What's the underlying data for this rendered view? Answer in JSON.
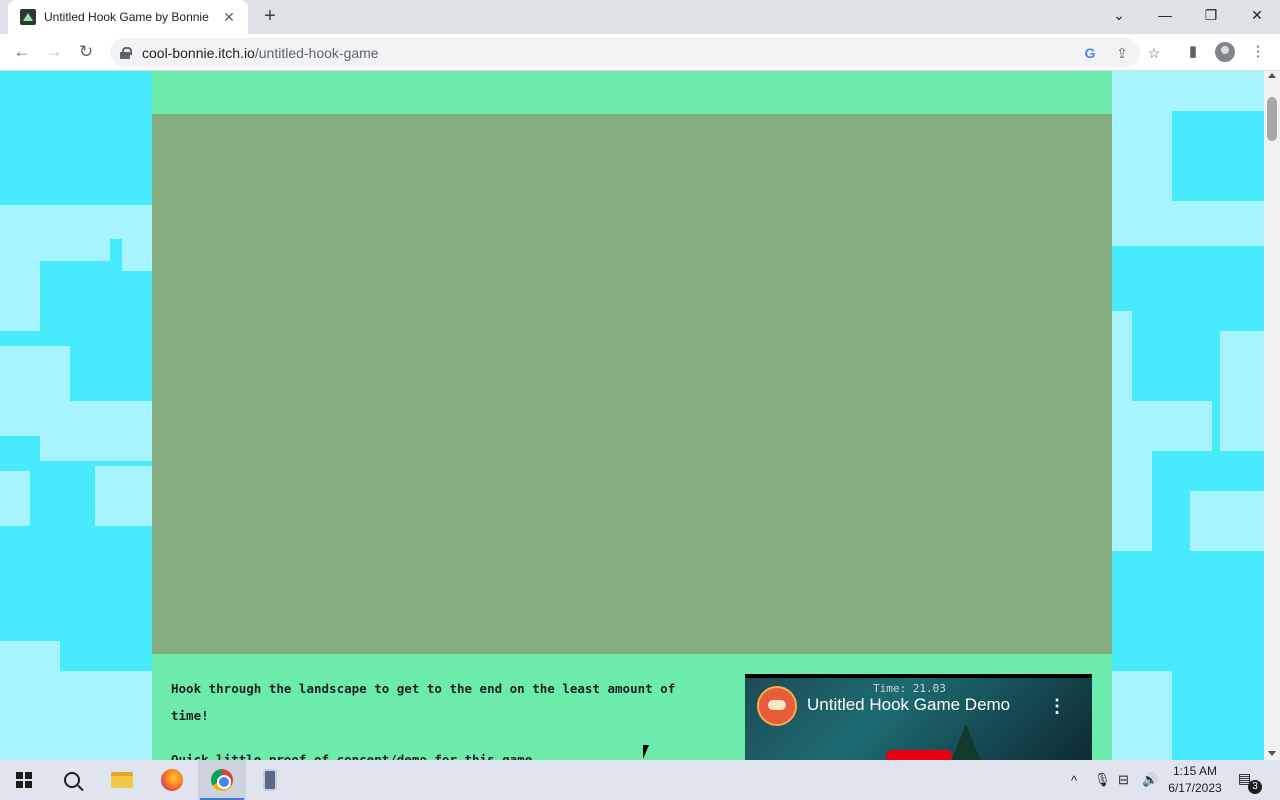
{
  "browser": {
    "tab_title": "Untitled Hook Game by Bonnie",
    "tab_close": "✕",
    "new_tab": "+",
    "url_host": "cool-bonnie.itch.io",
    "url_path": "/untitled-hook-game",
    "controls": {
      "tab_search": "⌄",
      "minimize": "—",
      "restore": "❐",
      "close": "✕"
    },
    "nav": {
      "back": "←",
      "forward": "→",
      "reload": "↻"
    },
    "omnibox_icons": {
      "google": "G",
      "share": "⇪",
      "bookmark": "☆"
    },
    "toolbar_icons": {
      "side_panel": "▮",
      "menu": "⋮"
    }
  },
  "page": {
    "description": [
      "Hook through the landscape to get to the end on the least amount of time!",
      "Quick little proof of concept/demo for this game"
    ],
    "video": {
      "title": "Untitled Hook Game Demo",
      "timer": "Time: 21.03",
      "menu": "⋮"
    },
    "colors": {
      "background": "#47ebfd",
      "page": "#6cebad",
      "game_frame": "#84ad80"
    }
  },
  "taskbar": {
    "time": "1:15 AM",
    "date": "6/17/2023",
    "notification_count": "3",
    "tray_icons": {
      "chevron": "^",
      "mic": "🎙",
      "network": "⊟",
      "volume": "🔊",
      "notifications": "▤"
    }
  }
}
